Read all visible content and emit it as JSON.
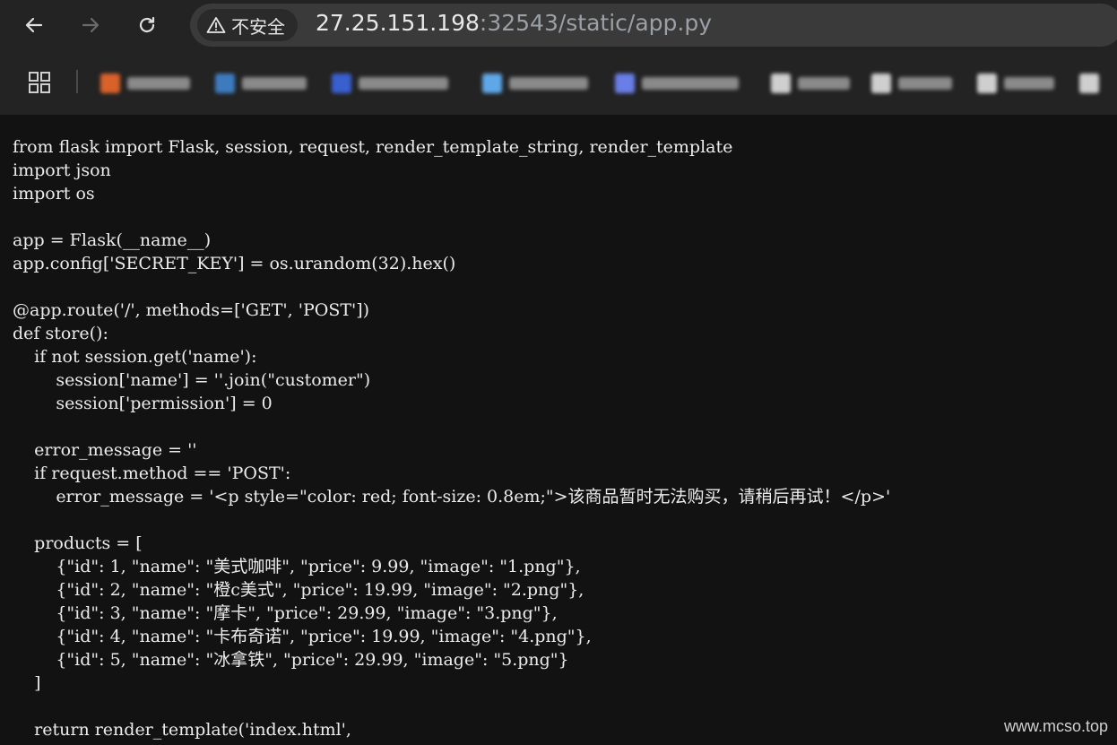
{
  "toolbar": {
    "back_icon": "arrow-left-icon",
    "forward_icon": "arrow-right-icon",
    "reload_icon": "reload-icon",
    "security_label": "不安全",
    "security_icon": "warning-triangle-icon",
    "url_host": "27.25.151.198",
    "url_rest": ":32543/static/app.py"
  },
  "bookmarks": {
    "apps_icon": "apps-grid-icon",
    "items": [
      {
        "favicon_color": "#d9622b",
        "label_blurred": true
      },
      {
        "favicon_color": "#3d7bbf",
        "label_blurred": true
      },
      {
        "favicon_color": "#3a5fcf",
        "label_blurred": true
      },
      {
        "favicon_color": "#5fa8e8",
        "label_blurred": true
      },
      {
        "favicon_color": "#6a7ee8",
        "label_blurred": true
      },
      {
        "favicon_color": "#cfcfcf",
        "label_blurred": true
      },
      {
        "favicon_color": "#cfcfcf",
        "label_blurred": true
      },
      {
        "favicon_color": "#cfcfcf",
        "label_blurred": true
      },
      {
        "favicon_color": "#cfcfcf",
        "label_blurred": true
      }
    ]
  },
  "code": {
    "lines": [
      "from flask import Flask, session, request, render_template_string, render_template",
      "import json",
      "import os",
      "",
      "app = Flask(__name__)",
      "app.config['SECRET_KEY'] = os.urandom(32).hex()",
      "",
      "@app.route('/', methods=['GET', 'POST'])",
      "def store():",
      "    if not session.get('name'):",
      "        session['name'] = ''.join(\"customer\")",
      "        session['permission'] = 0",
      "",
      "    error_message = ''",
      "    if request.method == 'POST':",
      "        error_message = '<p style=\"color: red; font-size: 0.8em;\">该商品暂时无法购买，请稍后再试！</p>'",
      "",
      "    products = [",
      "        {\"id\": 1, \"name\": \"美式咖啡\", \"price\": 9.99, \"image\": \"1.png\"},",
      "        {\"id\": 2, \"name\": \"橙c美式\", \"price\": 19.99, \"image\": \"2.png\"},",
      "        {\"id\": 3, \"name\": \"摩卡\", \"price\": 29.99, \"image\": \"3.png\"},",
      "        {\"id\": 4, \"name\": \"卡布奇诺\", \"price\": 19.99, \"image\": \"4.png\"},",
      "        {\"id\": 5, \"name\": \"冰拿铁\", \"price\": 29.99, \"image\": \"5.png\"}",
      "    ]",
      "",
      "    return render_template('index.html',"
    ]
  },
  "watermark": "www.mcso.top"
}
